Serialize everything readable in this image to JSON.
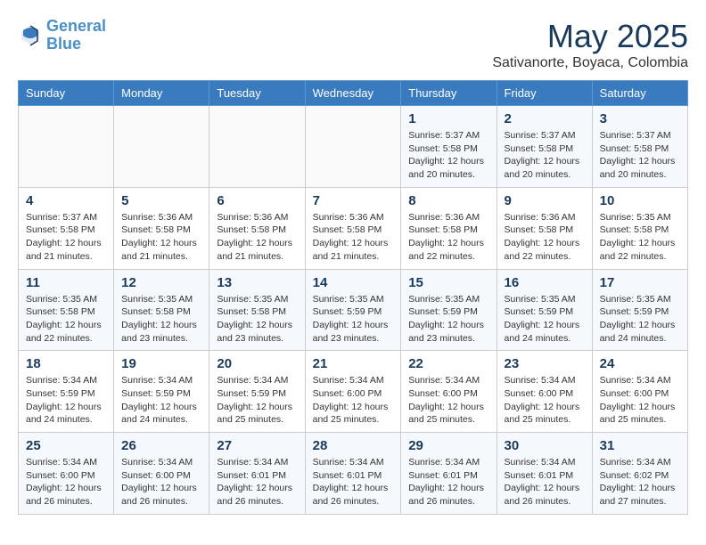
{
  "header": {
    "logo_line1": "General",
    "logo_line2": "Blue",
    "month": "May 2025",
    "location": "Sativanorte, Boyaca, Colombia"
  },
  "weekdays": [
    "Sunday",
    "Monday",
    "Tuesday",
    "Wednesday",
    "Thursday",
    "Friday",
    "Saturday"
  ],
  "weeks": [
    [
      {
        "day": "",
        "info": ""
      },
      {
        "day": "",
        "info": ""
      },
      {
        "day": "",
        "info": ""
      },
      {
        "day": "",
        "info": ""
      },
      {
        "day": "1",
        "info": "Sunrise: 5:37 AM\nSunset: 5:58 PM\nDaylight: 12 hours and 20 minutes."
      },
      {
        "day": "2",
        "info": "Sunrise: 5:37 AM\nSunset: 5:58 PM\nDaylight: 12 hours and 20 minutes."
      },
      {
        "day": "3",
        "info": "Sunrise: 5:37 AM\nSunset: 5:58 PM\nDaylight: 12 hours and 20 minutes."
      }
    ],
    [
      {
        "day": "4",
        "info": "Sunrise: 5:37 AM\nSunset: 5:58 PM\nDaylight: 12 hours and 21 minutes."
      },
      {
        "day": "5",
        "info": "Sunrise: 5:36 AM\nSunset: 5:58 PM\nDaylight: 12 hours and 21 minutes."
      },
      {
        "day": "6",
        "info": "Sunrise: 5:36 AM\nSunset: 5:58 PM\nDaylight: 12 hours and 21 minutes."
      },
      {
        "day": "7",
        "info": "Sunrise: 5:36 AM\nSunset: 5:58 PM\nDaylight: 12 hours and 21 minutes."
      },
      {
        "day": "8",
        "info": "Sunrise: 5:36 AM\nSunset: 5:58 PM\nDaylight: 12 hours and 22 minutes."
      },
      {
        "day": "9",
        "info": "Sunrise: 5:36 AM\nSunset: 5:58 PM\nDaylight: 12 hours and 22 minutes."
      },
      {
        "day": "10",
        "info": "Sunrise: 5:35 AM\nSunset: 5:58 PM\nDaylight: 12 hours and 22 minutes."
      }
    ],
    [
      {
        "day": "11",
        "info": "Sunrise: 5:35 AM\nSunset: 5:58 PM\nDaylight: 12 hours and 22 minutes."
      },
      {
        "day": "12",
        "info": "Sunrise: 5:35 AM\nSunset: 5:58 PM\nDaylight: 12 hours and 23 minutes."
      },
      {
        "day": "13",
        "info": "Sunrise: 5:35 AM\nSunset: 5:58 PM\nDaylight: 12 hours and 23 minutes."
      },
      {
        "day": "14",
        "info": "Sunrise: 5:35 AM\nSunset: 5:59 PM\nDaylight: 12 hours and 23 minutes."
      },
      {
        "day": "15",
        "info": "Sunrise: 5:35 AM\nSunset: 5:59 PM\nDaylight: 12 hours and 23 minutes."
      },
      {
        "day": "16",
        "info": "Sunrise: 5:35 AM\nSunset: 5:59 PM\nDaylight: 12 hours and 24 minutes."
      },
      {
        "day": "17",
        "info": "Sunrise: 5:35 AM\nSunset: 5:59 PM\nDaylight: 12 hours and 24 minutes."
      }
    ],
    [
      {
        "day": "18",
        "info": "Sunrise: 5:34 AM\nSunset: 5:59 PM\nDaylight: 12 hours and 24 minutes."
      },
      {
        "day": "19",
        "info": "Sunrise: 5:34 AM\nSunset: 5:59 PM\nDaylight: 12 hours and 24 minutes."
      },
      {
        "day": "20",
        "info": "Sunrise: 5:34 AM\nSunset: 5:59 PM\nDaylight: 12 hours and 25 minutes."
      },
      {
        "day": "21",
        "info": "Sunrise: 5:34 AM\nSunset: 6:00 PM\nDaylight: 12 hours and 25 minutes."
      },
      {
        "day": "22",
        "info": "Sunrise: 5:34 AM\nSunset: 6:00 PM\nDaylight: 12 hours and 25 minutes."
      },
      {
        "day": "23",
        "info": "Sunrise: 5:34 AM\nSunset: 6:00 PM\nDaylight: 12 hours and 25 minutes."
      },
      {
        "day": "24",
        "info": "Sunrise: 5:34 AM\nSunset: 6:00 PM\nDaylight: 12 hours and 25 minutes."
      }
    ],
    [
      {
        "day": "25",
        "info": "Sunrise: 5:34 AM\nSunset: 6:00 PM\nDaylight: 12 hours and 26 minutes."
      },
      {
        "day": "26",
        "info": "Sunrise: 5:34 AM\nSunset: 6:00 PM\nDaylight: 12 hours and 26 minutes."
      },
      {
        "day": "27",
        "info": "Sunrise: 5:34 AM\nSunset: 6:01 PM\nDaylight: 12 hours and 26 minutes."
      },
      {
        "day": "28",
        "info": "Sunrise: 5:34 AM\nSunset: 6:01 PM\nDaylight: 12 hours and 26 minutes."
      },
      {
        "day": "29",
        "info": "Sunrise: 5:34 AM\nSunset: 6:01 PM\nDaylight: 12 hours and 26 minutes."
      },
      {
        "day": "30",
        "info": "Sunrise: 5:34 AM\nSunset: 6:01 PM\nDaylight: 12 hours and 26 minutes."
      },
      {
        "day": "31",
        "info": "Sunrise: 5:34 AM\nSunset: 6:02 PM\nDaylight: 12 hours and 27 minutes."
      }
    ]
  ]
}
